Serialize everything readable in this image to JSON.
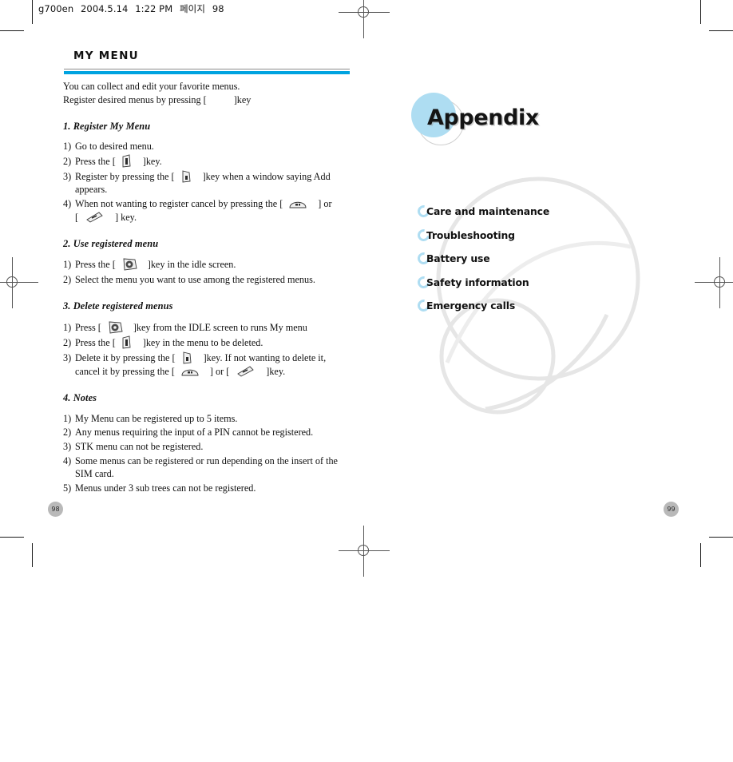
{
  "file_info": {
    "filename": "g700en",
    "date": "2004.5.14",
    "time": "1:22 PM",
    "locale_text": "페이지",
    "page": "98"
  },
  "left_page": {
    "title": "MY MENU",
    "accent_color": "#00A3E0",
    "page_number": "98",
    "intro": {
      "line1": "You can collect and edit your favorite menus.",
      "line2_pre": "Register desired menus by pressing [",
      "line2_icon": "menu-key-icon",
      "line2_post": "]key"
    },
    "sections": [
      {
        "heading": "1. Register My Menu",
        "steps": [
          {
            "num": "1)",
            "parts": [
              {
                "text": "Go to desired menu."
              }
            ]
          },
          {
            "num": "2)",
            "parts": [
              {
                "text": "Press the ["
              },
              {
                "icon": "menu-key-icon"
              },
              {
                "text": "]key."
              }
            ]
          },
          {
            "num": "3)",
            "parts": [
              {
                "text": "Register by pressing the ["
              },
              {
                "icon": "select-key-icon"
              },
              {
                "text": "]key when a window saying Add"
              }
            ],
            "cont": "appears."
          },
          {
            "num": "4)",
            "parts": [
              {
                "text": "When not wanting to register cancel by pressing the ["
              },
              {
                "icon": "clear-key-icon"
              },
              {
                "text": "] or"
              }
            ],
            "cont_parts": [
              {
                "text": "["
              },
              {
                "icon": "end-key-icon"
              },
              {
                "text": "] key."
              }
            ]
          }
        ]
      },
      {
        "heading": "2. Use registered menu",
        "steps": [
          {
            "num": "1)",
            "parts": [
              {
                "text": "Press the ["
              },
              {
                "icon": "nav-key-icon"
              },
              {
                "text": "]key in the idle screen."
              }
            ]
          },
          {
            "num": "2)",
            "parts": [
              {
                "text": "Select the menu you want to use among the registered menus."
              }
            ]
          }
        ]
      },
      {
        "heading": "3. Delete registered menus",
        "steps": [
          {
            "num": "1)",
            "parts": [
              {
                "text": "Press ["
              },
              {
                "icon": "nav-key-icon"
              },
              {
                "text": "]key from the IDLE screen to runs My menu"
              }
            ]
          },
          {
            "num": "2)",
            "parts": [
              {
                "text": "Press the ["
              },
              {
                "icon": "menu-key-icon"
              },
              {
                "text": "]key in the menu to be deleted."
              }
            ]
          },
          {
            "num": "3)",
            "parts": [
              {
                "text": "Delete it by pressing the ["
              },
              {
                "icon": "select-key-icon"
              },
              {
                "text": "]key. If not wanting to delete it,"
              }
            ],
            "cont_parts": [
              {
                "text": "cancel it by pressing the ["
              },
              {
                "icon": "clear-key-icon"
              },
              {
                "text": "] or ["
              },
              {
                "icon": "end-key-icon"
              },
              {
                "text": "]key."
              }
            ]
          }
        ]
      },
      {
        "heading": "4. Notes",
        "steps": [
          {
            "num": "1)",
            "parts": [
              {
                "text": "My Menu can be registered up to 5 items."
              }
            ]
          },
          {
            "num": "2)",
            "parts": [
              {
                "text": "Any menus requiring the input of a PIN cannot be registered."
              }
            ]
          },
          {
            "num": "3)",
            "parts": [
              {
                "text": "STK menu can not be registered."
              }
            ]
          },
          {
            "num": "4)",
            "parts": [
              {
                "text": "Some menus can be registered or run depending on the insert of the"
              }
            ],
            "cont": "SIM card."
          },
          {
            "num": "5)",
            "parts": [
              {
                "text": "Menus under 3 sub trees can not be registered."
              }
            ]
          }
        ]
      }
    ]
  },
  "right_page": {
    "title": "Appendix",
    "badge_color": "#AEDDF2",
    "page_number": "99",
    "items": [
      {
        "label": "Care and maintenance"
      },
      {
        "label": "Troubleshooting"
      },
      {
        "label": "Battery use"
      },
      {
        "label": "Safety information"
      },
      {
        "label": "Emergency calls"
      }
    ]
  }
}
